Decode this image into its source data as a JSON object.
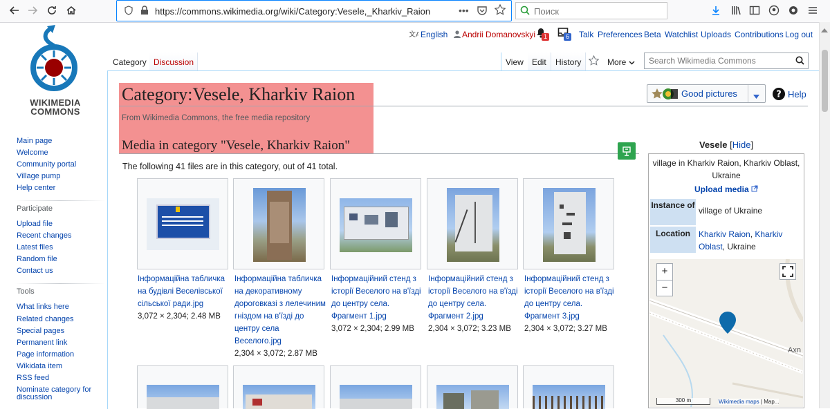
{
  "browser": {
    "url": "https://commons.wikimedia.org/wiki/Category:Vesele,_Kharkiv_Raion",
    "search_placeholder": "Поиск"
  },
  "logo": {
    "line1": "WIKIMEDIA",
    "line2": "COMMONS"
  },
  "sidebar": {
    "nav": [
      "Main page",
      "Welcome",
      "Community portal",
      "Village pump",
      "Help center"
    ],
    "participate_heading": "Participate",
    "participate": [
      "Upload file",
      "Recent changes",
      "Latest files",
      "Random file",
      "Contact us"
    ],
    "tools_heading": "Tools",
    "tools": [
      "What links here",
      "Related changes",
      "Special pages",
      "Permanent link",
      "Page information",
      "Wikidata item",
      "RSS feed",
      "Nominate category for discussion"
    ]
  },
  "personal": {
    "language": "English",
    "user": "Andrii Domanovskyi",
    "alerts_count": "1",
    "notices_count": "6",
    "links": [
      "Talk",
      "Preferences",
      "Beta",
      "Watchlist",
      "Uploads",
      "Contributions",
      "Log out"
    ]
  },
  "tabs": {
    "left": [
      "Category",
      "Discussion"
    ],
    "view": "View",
    "edit": "Edit",
    "history": "History",
    "more": "More",
    "search_placeholder": "Search Wikimedia Commons"
  },
  "page": {
    "title": "Category:Vesele, Kharkiv Raion",
    "tagline": "From Wikimedia Commons, the free media repository",
    "media_heading": "Media in category \"Vesele, Kharkiv Raion\"",
    "count_text": "The following 41 files are in this category, out of 41 total.",
    "good_pictures": "Good pictures",
    "help": "Help"
  },
  "files": [
    {
      "name": "Інформаційна табличка на будівлі Веселівської сільської ради.jpg",
      "size": "3,072 × 2,304; 2.48 MB"
    },
    {
      "name": "Інформаційна табличка на декоративному дороговказі з лелечиним гніздом на в'їзді до центру села Веселого.jpg",
      "size": "2,304 × 3,072; 2.87 MB"
    },
    {
      "name": "Інформаційний стенд з історії Веселого на в'їзді до центру села. Фрагмент 1.jpg",
      "size": "3,072 × 2,304; 2.99 MB"
    },
    {
      "name": "Інформаційний стенд з історії Веселого на в'їзді до центру села. Фрагмент 2.jpg",
      "size": "2,304 × 3,072; 3.23 MB"
    },
    {
      "name": "Інформаційний стенд з історії Веселого на в'їзді до центру села. Фрагмент 3.jpg",
      "size": "2,304 × 3,072; 3.27 MB"
    }
  ],
  "infobox": {
    "title": "Vesele",
    "hide": "Hide",
    "description": "village in Kharkiv Raion, Kharkiv Oblast, Ukraine",
    "upload": "Upload media",
    "instance_label": "Instance of",
    "instance_value": "village of Ukraine",
    "location_label": "Location",
    "location_link1": "Kharkiv Raion",
    "location_sep": ", ",
    "location_link2": "Kharkiv Oblast",
    "location_rest": ", Ukraine",
    "map_scale": "300 m",
    "map_credit": "Wikimedia maps",
    "map_credit2": " | Map...",
    "map_road": "Axn",
    "zoom_in": "+",
    "zoom_out": "−"
  },
  "colors": {
    "link": "#0645ad",
    "highlight": "#f28b8b",
    "marker": "#0e6bab"
  }
}
